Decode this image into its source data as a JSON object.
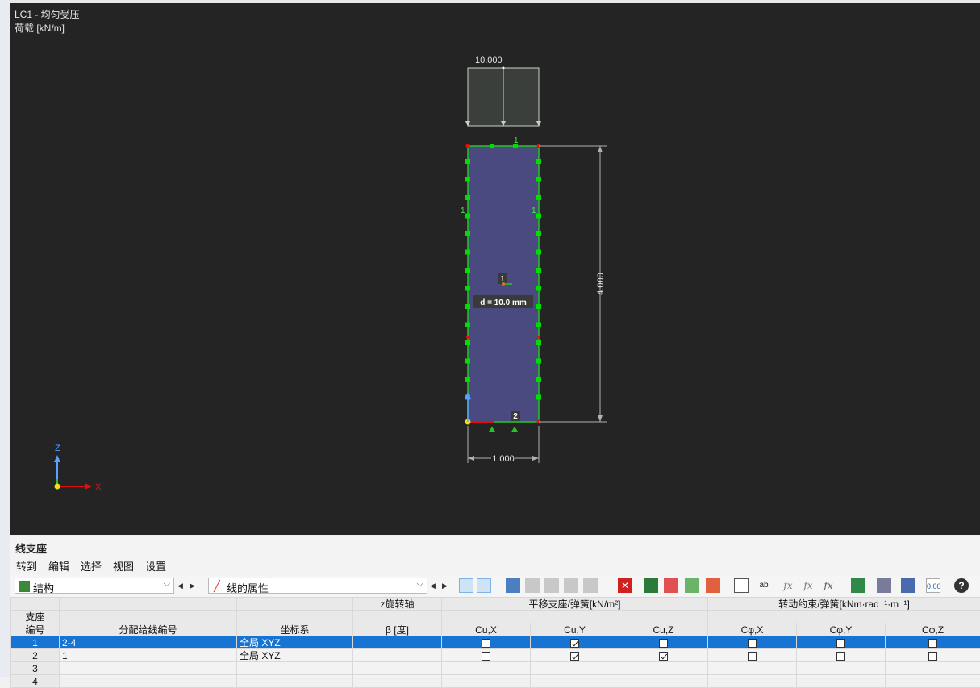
{
  "viewport": {
    "title_line1": "LC1 - 均匀受压",
    "title_line2": "荷载 [kN/m]",
    "load_value": "10.000",
    "dim_height": "4.000",
    "dim_width": "1.000",
    "thickness_label": "d = 10.0 mm",
    "node_label": "1",
    "line_label_left": "1",
    "line_label_right": "1",
    "line_label_top": "1",
    "line_label_bottom": "2",
    "axis_z": "Z",
    "axis_x": "X"
  },
  "panel": {
    "title": "线支座",
    "menu": [
      "转到",
      "编辑",
      "选择",
      "视图",
      "设置"
    ],
    "combo_left": "结构",
    "combo_right": "线的属性"
  },
  "table": {
    "group_headers": {
      "rotation_axis": "z旋转轴",
      "translational": "平移支座/弹簧[kN/m²]",
      "rotational": "转动约束/弹簧[kNm·rad⁻¹·m⁻¹]"
    },
    "headers": {
      "support_no_1": "支座",
      "support_no_2": "编号",
      "assigned_lines": "分配给线编号",
      "coord_system": "坐标系",
      "beta": "β [度]",
      "cux": "Cu,X",
      "cuy": "Cu,Y",
      "cuz": "Cu,Z",
      "cphix": "Cφ,X",
      "cphiy": "Cφ,Y",
      "cphiz": "Cφ,Z"
    },
    "rows": [
      {
        "no": "1",
        "lines": "2-4",
        "coord": "全局 XYZ",
        "beta": "",
        "cux": false,
        "cuy": true,
        "cuz": false,
        "cphix": false,
        "cphiy": false,
        "cphiz": false,
        "selected": true
      },
      {
        "no": "2",
        "lines": "1",
        "coord": "全局 XYZ",
        "beta": "",
        "cux": false,
        "cuy": true,
        "cuz": true,
        "cphix": false,
        "cphiy": false,
        "cphiz": false,
        "selected": false
      },
      {
        "no": "3",
        "lines": "",
        "coord": "",
        "beta": "",
        "cux": null,
        "cuy": null,
        "cuz": null,
        "cphix": null,
        "cphiy": null,
        "cphiz": null,
        "selected": false
      },
      {
        "no": "4",
        "lines": "",
        "coord": "",
        "beta": "",
        "cux": null,
        "cuy": null,
        "cuz": null,
        "cphix": null,
        "cphiy": null,
        "cphiz": null,
        "selected": false
      }
    ]
  },
  "colors": {
    "viewport_bg": "#242424",
    "surface_fill": "#4a4a80",
    "support_green": "#00dd00",
    "selection_blue": "#1874d2"
  }
}
